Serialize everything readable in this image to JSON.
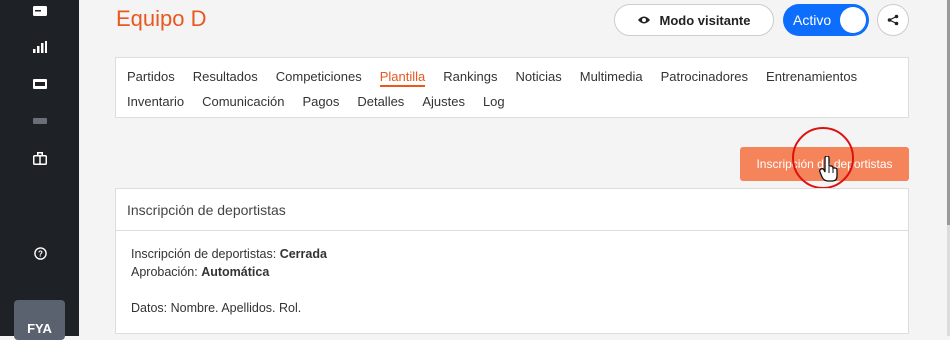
{
  "sidebar": {
    "icons": [
      "card-icon",
      "bar-chart-icon",
      "ticket-icon",
      "tag-icon",
      "briefcase-icon",
      "help-icon"
    ],
    "avatar": "FYA"
  },
  "header": {
    "title": "Equipo D",
    "visit_label": "Modo visitante",
    "active_label": "Activo"
  },
  "tabs": {
    "row1": [
      "Partidos",
      "Resultados",
      "Competiciones",
      "Plantilla",
      "Rankings",
      "Noticias",
      "Multimedia",
      "Patrocinadores",
      "Entrenamientos"
    ],
    "row2": [
      "Inventario",
      "Comunicación",
      "Pagos",
      "Detalles",
      "Ajustes",
      "Log"
    ],
    "active": "Plantilla"
  },
  "action": {
    "inscription_button": "Inscripción de deportistas"
  },
  "card": {
    "title": "Inscripción de deportistas",
    "status_label": "Inscripción de deportistas:",
    "status_value": "Cerrada",
    "approval_label": "Aprobación:",
    "approval_value": "Automática",
    "data_line": "Datos: Nombre. Apellidos. Rol."
  },
  "colors": {
    "accent": "#e8581f",
    "button_orange": "#f5845a",
    "toggle_blue": "#0d6efd",
    "sidebar": "#1e2126"
  }
}
